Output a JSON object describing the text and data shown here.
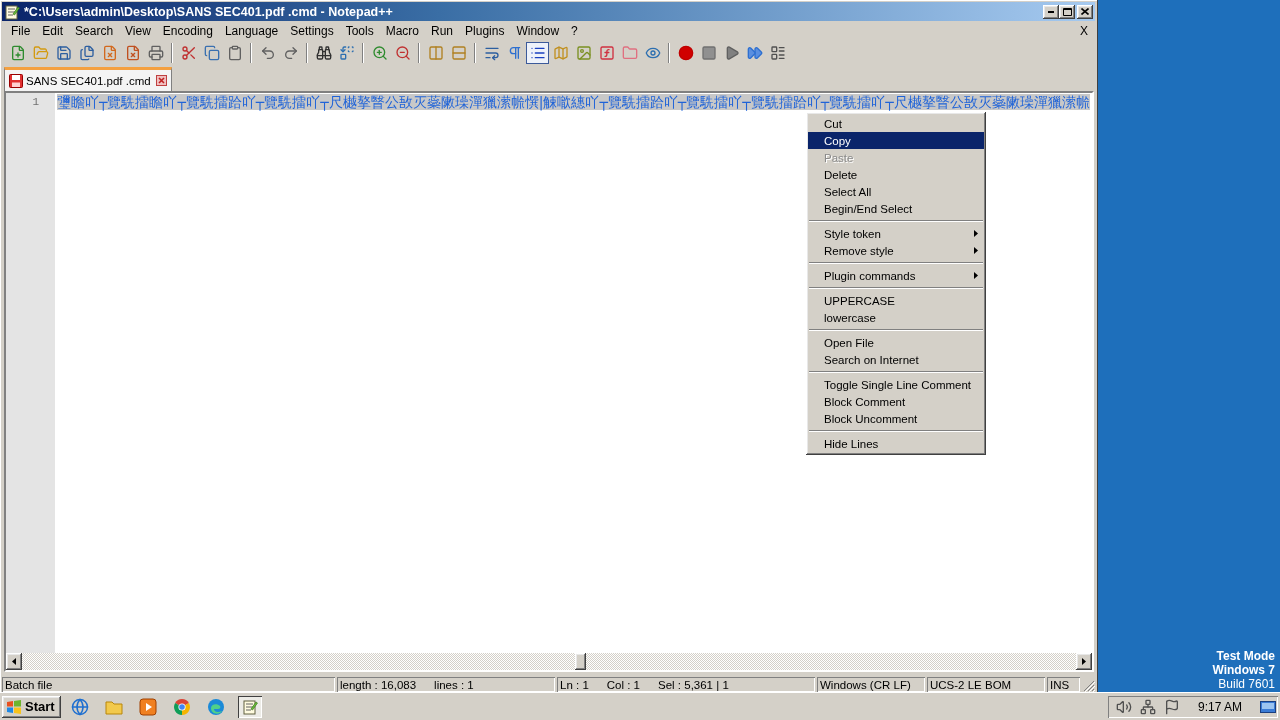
{
  "window": {
    "title": "*C:\\Users\\admin\\Desktop\\SANS SEC401.pdf .cmd - Notepad++"
  },
  "menu_bar": {
    "items": [
      "File",
      "Edit",
      "Search",
      "View",
      "Encoding",
      "Language",
      "Settings",
      "Tools",
      "Macro",
      "Run",
      "Plugins",
      "Window",
      "?"
    ],
    "close_document": "X"
  },
  "toolbar": {
    "groups": [
      [
        {
          "on": false
        },
        {
          "on": false
        },
        {
          "on": false
        },
        {
          "on": false
        },
        {
          "on": false
        },
        {
          "on": false
        },
        {
          "on": false
        }
      ],
      [
        {
          "on": false
        },
        {
          "on": false
        },
        {
          "on": false
        }
      ],
      [
        {
          "on": false
        },
        {
          "on": false
        }
      ],
      [
        {
          "on": false
        },
        {
          "on": false
        }
      ],
      [
        {
          "on": false
        },
        {
          "on": false
        }
      ],
      [
        {
          "on": false
        },
        {
          "on": false
        }
      ],
      [
        {
          "on": false
        },
        {
          "on": false
        },
        {
          "on": true
        },
        {
          "on": false
        },
        {
          "on": false
        },
        {
          "on": false
        },
        {
          "on": false
        },
        {
          "on": false
        }
      ],
      [
        {
          "on": false
        },
        {
          "on": false
        },
        {
          "on": false
        },
        {
          "on": false
        },
        {
          "on": false
        }
      ]
    ]
  },
  "tabs": [
    {
      "label": "SANS SEC401.pdf .cmd",
      "selected": true,
      "modified": true
    }
  ],
  "editor": {
    "lines": [
      {
        "number": "1",
        "text": "瓕瞻吖┬覽駪擂瞻吖┬覽駪擂跲吖┬覽駪擂吖┬尺樾摮瞖公敔灭蘂敶璪潬獵潆㡃㦏|觫噷繐吖┬覽駪擂跲吖┬覽駪擂吖┬覽駪擂跲吖┬覽駪擂吖┬尺樾摮瞖公敔灭蘂敶璪潬獵潆㡃",
        "selected": true
      }
    ]
  },
  "context_menu": {
    "groups": [
      [
        {
          "label": "Cut",
          "selected": false,
          "disabled": false,
          "submenu": false
        },
        {
          "label": "Copy",
          "selected": true,
          "disabled": false,
          "submenu": false
        },
        {
          "label": "Paste",
          "selected": false,
          "disabled": true,
          "submenu": false
        },
        {
          "label": "Delete",
          "selected": false,
          "disabled": false,
          "submenu": false
        },
        {
          "label": "Select All",
          "selected": false,
          "disabled": false,
          "submenu": false
        },
        {
          "label": "Begin/End Select",
          "selected": false,
          "disabled": false,
          "submenu": false
        }
      ],
      [
        {
          "label": "Style token",
          "selected": false,
          "disabled": false,
          "submenu": true
        },
        {
          "label": "Remove style",
          "selected": false,
          "disabled": false,
          "submenu": true
        }
      ],
      [
        {
          "label": "Plugin commands",
          "selected": false,
          "disabled": false,
          "submenu": true
        }
      ],
      [
        {
          "label": "UPPERCASE",
          "selected": false,
          "disabled": false,
          "submenu": false
        },
        {
          "label": "lowercase",
          "selected": false,
          "disabled": false,
          "submenu": false
        }
      ],
      [
        {
          "label": "Open File",
          "selected": false,
          "disabled": false,
          "submenu": false
        },
        {
          "label": "Search on Internet",
          "selected": false,
          "disabled": false,
          "submenu": false
        }
      ],
      [
        {
          "label": "Toggle Single Line Comment",
          "selected": false,
          "disabled": false,
          "submenu": false
        },
        {
          "label": "Block Comment",
          "selected": false,
          "disabled": false,
          "submenu": false
        },
        {
          "label": "Block Uncomment",
          "selected": false,
          "disabled": false,
          "submenu": false
        }
      ],
      [
        {
          "label": "Hide Lines",
          "selected": false,
          "disabled": false,
          "submenu": false
        }
      ]
    ]
  },
  "status_bar": {
    "sections": [
      {
        "texts": [
          "Batch file"
        ]
      },
      {
        "texts": [
          "length : 16,083",
          "lines : 1"
        ]
      },
      {
        "texts": [
          "Ln : 1",
          "Col : 1",
          "Sel : 5,361 | 1"
        ]
      },
      {
        "texts": [
          "Windows (CR LF)"
        ]
      },
      {
        "texts": [
          "UCS-2 LE BOM"
        ]
      },
      {
        "texts": [
          "INS"
        ]
      }
    ]
  },
  "desktop": {
    "notice": [
      "Test Mode",
      "Windows 7",
      "Build 7601"
    ]
  },
  "taskbar": {
    "start": "Start",
    "apps": [
      {
        "selected": false
      },
      {
        "selected": false
      },
      {
        "selected": false
      },
      {
        "selected": false
      },
      {
        "selected": false
      },
      {
        "selected": true
      }
    ],
    "clock": "9:17 AM"
  }
}
